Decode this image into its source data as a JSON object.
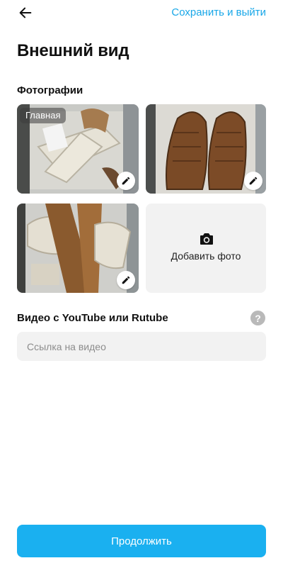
{
  "header": {
    "save_exit_label": "Сохранить и выйти"
  },
  "page": {
    "title": "Внешний вид"
  },
  "photos_section": {
    "label": "Фотографии",
    "main_badge": "Главная",
    "add_photo_label": "Добавить фото"
  },
  "video_section": {
    "label": "Видео с YouTube или Rutube",
    "help_text": "?",
    "input_placeholder": "Ссылка на видео"
  },
  "footer": {
    "continue_label": "Продолжить"
  },
  "colors": {
    "accent": "#18a7e8",
    "button": "#1ab0f0",
    "field_bg": "#f2f2f2"
  }
}
